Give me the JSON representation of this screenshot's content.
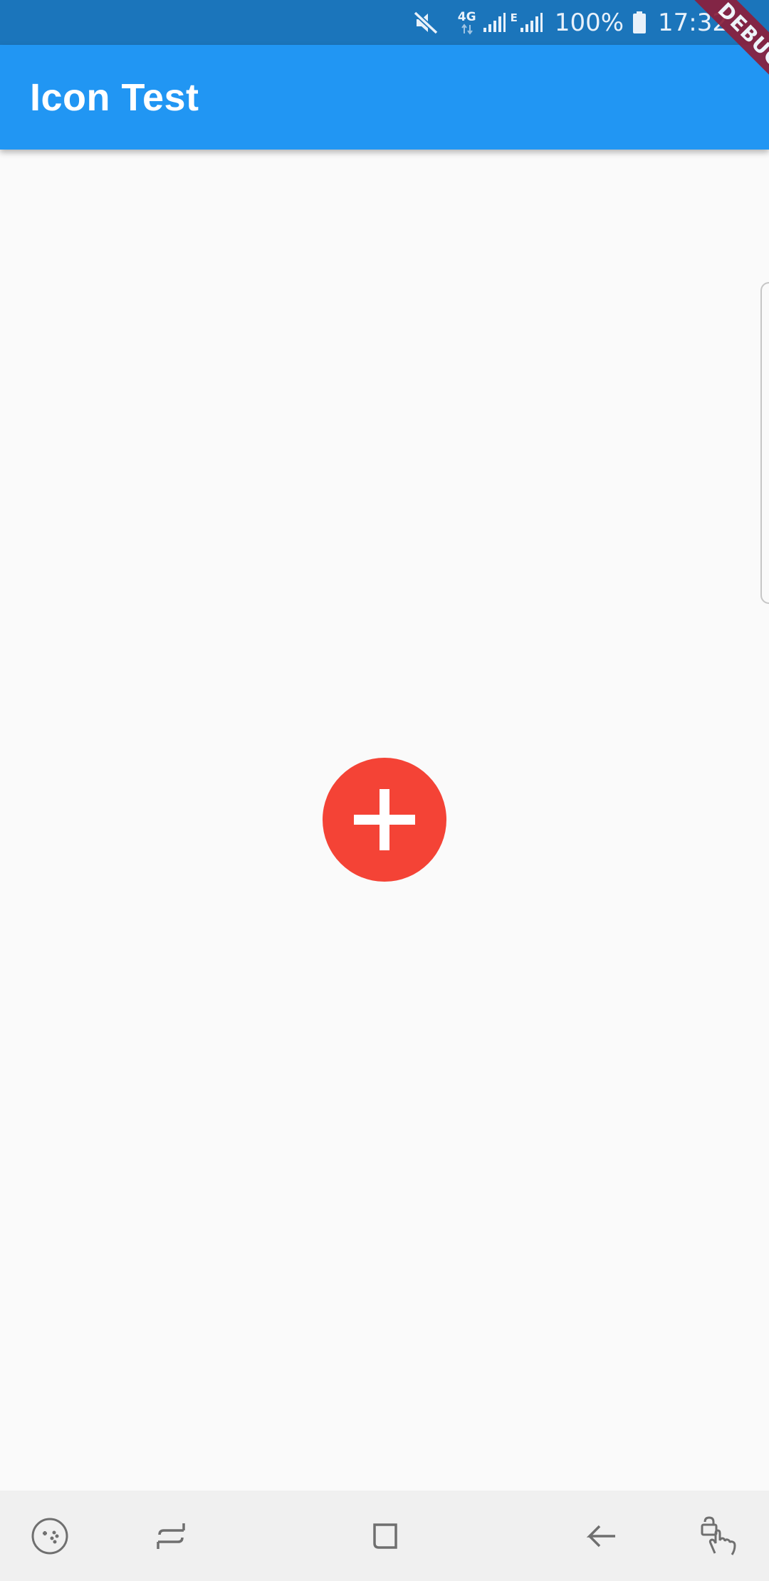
{
  "status_bar": {
    "network": "4G",
    "network_secondary": "E",
    "battery": "100%",
    "time": "17:32",
    "icons": [
      "mute-icon",
      "data-arrows-icon",
      "signal-icon",
      "signal-icon",
      "battery-icon"
    ]
  },
  "app_bar": {
    "title": "Icon Test"
  },
  "debug_banner": {
    "label": "DEBUG"
  },
  "main": {
    "button": {
      "icon": "add-circle-icon",
      "color": "#f44336"
    }
  },
  "nav_bar": {
    "buttons": [
      {
        "icon": "game-tools-icon"
      },
      {
        "icon": "recents-icon"
      },
      {
        "icon": "home-icon"
      },
      {
        "icon": "back-icon"
      },
      {
        "icon": "screen-lock-icon"
      }
    ]
  },
  "colors": {
    "status_bar": "#1b75bb",
    "app_bar": "#2196f3",
    "background": "#fafafa",
    "accent": "#f44336",
    "nav_bar": "#f0f0f0"
  }
}
